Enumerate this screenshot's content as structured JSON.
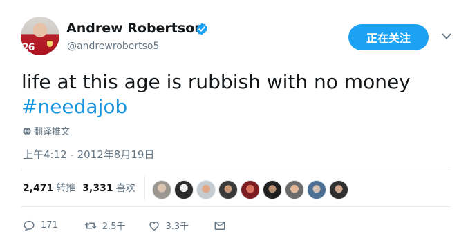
{
  "author": {
    "display_name": "Andrew Robertson",
    "handle": "@andrewrobertso5",
    "avatar_jersey_number": "26",
    "verified": true
  },
  "follow_button": {
    "label": "正在关注"
  },
  "tweet": {
    "text": "life at this age is rubbish with no money",
    "hashtag": "#needajob",
    "translate_label": "翻译推文",
    "timestamp": "上午4:12 - 2012年8月19日"
  },
  "stats": {
    "retweets_count": "2,471",
    "retweets_label": "转推",
    "likes_count": "3,331",
    "likes_label": "喜欢",
    "liker_avatar_count": 9
  },
  "actions": {
    "reply_count": "171",
    "retweet_count": "2.5千",
    "like_count": "3.3千"
  },
  "colors": {
    "accent": "#1da1f2",
    "hashtag": "#1b95e0",
    "secondary_text": "#657786",
    "divider": "#e6ecf0"
  },
  "icons": [
    "verified-badge-icon",
    "chevron-down-icon",
    "globe-icon",
    "reply-icon",
    "retweet-icon",
    "heart-icon",
    "direct-message-icon"
  ]
}
